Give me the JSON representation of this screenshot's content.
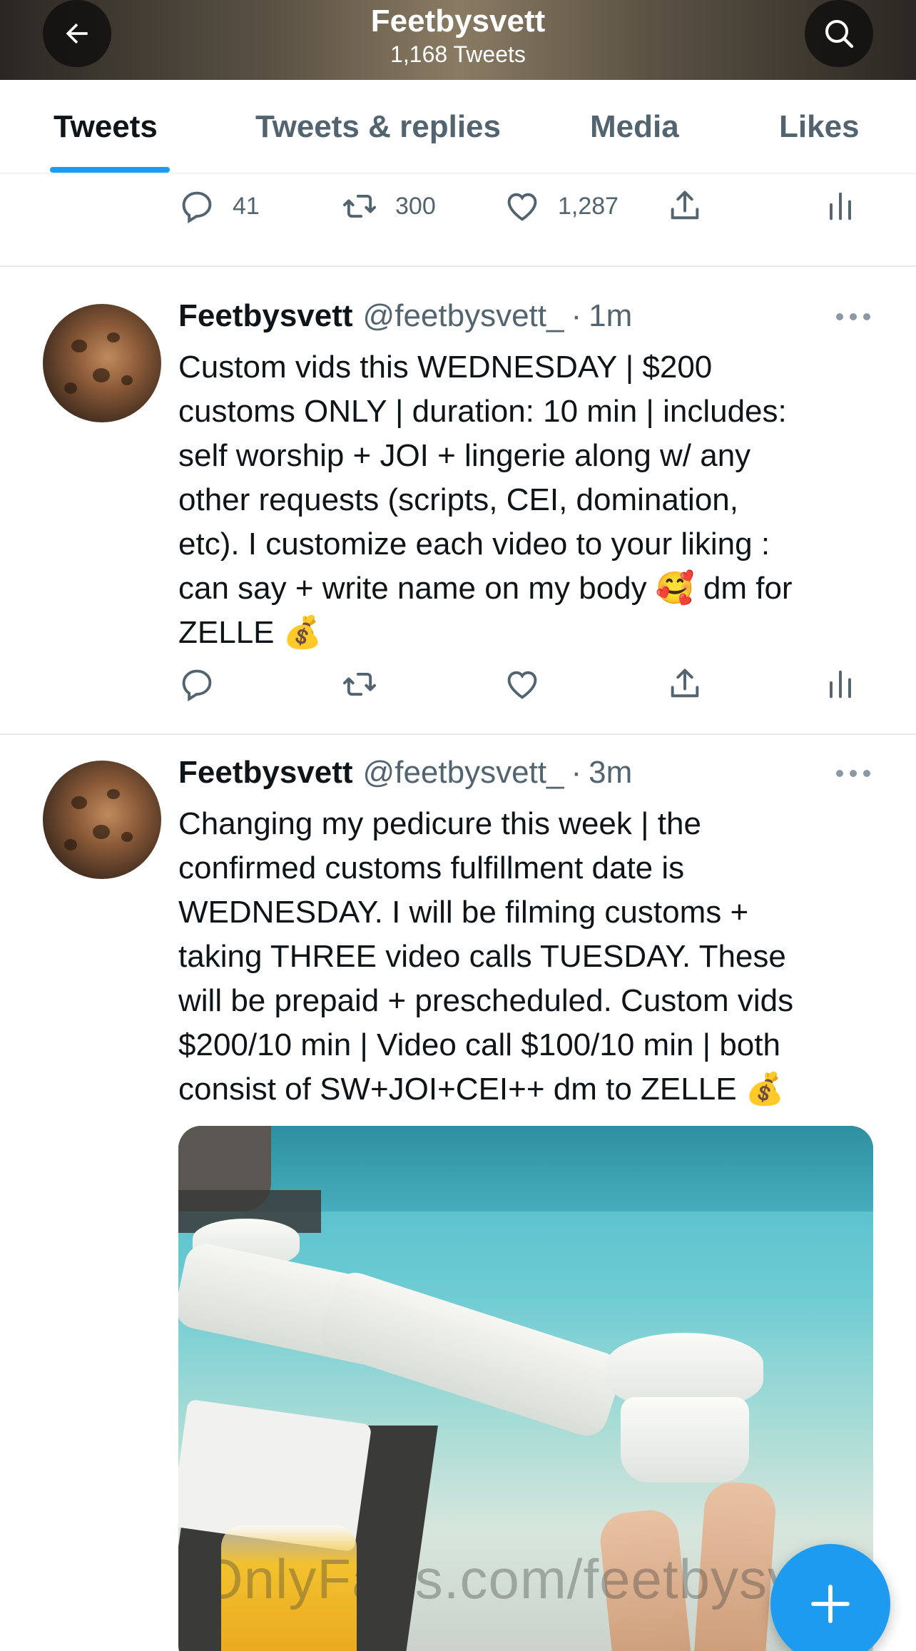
{
  "header": {
    "title": "Feetbysvett",
    "tweet_count": "1,168 Tweets"
  },
  "tabs": [
    {
      "label": "Tweets",
      "active": true
    },
    {
      "label": "Tweets & replies",
      "active": false
    },
    {
      "label": "Media",
      "active": false
    },
    {
      "label": "Likes",
      "active": false
    }
  ],
  "previous_tweet_actions": {
    "replies": "41",
    "retweets": "300",
    "likes": "1,287"
  },
  "tweets": [
    {
      "name": "Feetbysvett",
      "handle": "@feetbysvett_",
      "separator": "·",
      "time": "1m",
      "text": "Custom vids this WEDNESDAY | $200\ncustoms ONLY | duration: 10 min | includes:\nself worship + JOI + lingerie along w/ any\nother requests (scripts, CEI, domination,\netc). I customize each video to your liking :\ncan say + write name on my body 🥰 dm for\nZELLE 💰"
    },
    {
      "name": "Feetbysvett",
      "handle": "@feetbysvett_",
      "separator": "·",
      "time": "3m",
      "text": "Changing my pedicure this week | the\nconfirmed customs fulfillment date is\nWEDNESDAY. I will be filming customs +\ntaking THREE video calls TUESDAY. These\nwill be prepaid + prescheduled. Custom vids\n$200/10 min | Video call $100/10 min | both\nconsist of SW+JOI+CEI++ dm to ZELLE 💰"
    }
  ],
  "watermark": "OnlyFans.com/feetbysvett",
  "colors": {
    "accent": "#1d9bf0",
    "secondary_text": "#536471",
    "primary_text": "#0f1419"
  },
  "icons": {
    "back": "arrow-left-icon",
    "search": "search-icon",
    "reply": "reply-icon",
    "retweet": "retweet-icon",
    "like": "heart-icon",
    "share": "share-icon",
    "analytics": "analytics-icon",
    "more": "more-icon",
    "compose": "plus-icon"
  }
}
